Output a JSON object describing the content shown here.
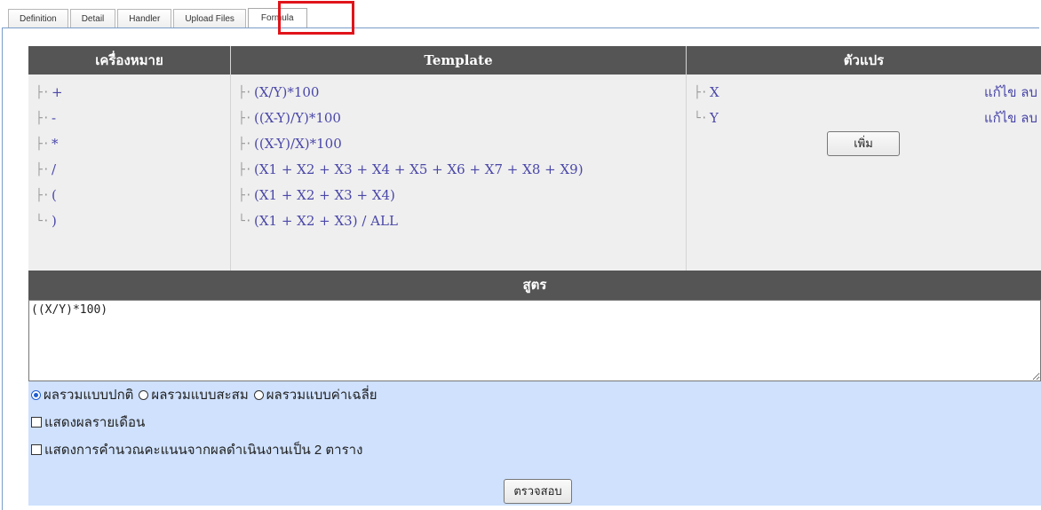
{
  "tabs": [
    {
      "label": "Definition"
    },
    {
      "label": "Detail"
    },
    {
      "label": "Handler"
    },
    {
      "label": "Upload Files"
    },
    {
      "label": "Formula",
      "active": true
    }
  ],
  "symbols": {
    "header": "เครื่องหมาย",
    "items": [
      "+",
      "-",
      "*",
      "/",
      "(",
      ")"
    ]
  },
  "templates": {
    "header": "Template",
    "items": [
      "(X/Y)*100",
      "((X-Y)/Y)*100",
      "((X-Y)/X)*100",
      "(X1 + X2 + X3 + X4 + X5 + X6 + X7 + X8 + X9)",
      "(X1 + X2 + X3 + X4)",
      "(X1 + X2 + X3) / ALL"
    ]
  },
  "variables": {
    "header": "ตัวแปร",
    "items": [
      {
        "name": "X",
        "edit": "แก้ไข",
        "delete": "ลบ"
      },
      {
        "name": "Y",
        "edit": "แก้ไข",
        "delete": "ลบ"
      }
    ],
    "add_label": "เพิ่ม"
  },
  "formula": {
    "header": "สูตร",
    "value": "((X/Y)*100)"
  },
  "options": {
    "radios": [
      {
        "label": "ผลรวมแบบปกติ",
        "checked": true
      },
      {
        "label": "ผลรวมแบบสะสม",
        "checked": false
      },
      {
        "label": "ผลรวมแบบค่าเฉลี่ย",
        "checked": false
      }
    ],
    "monthly_label": "แสดงผลรายเดือน",
    "two_tables_label": "แสดงการคำนวณคะแนนจากผลดำเนินงานเป็น 2 ตาราง",
    "verify_label": "ตรวจสอบ"
  },
  "colors": {
    "header_bg": "#555555",
    "panel_bg": "#efefef",
    "link": "#4a47a8",
    "options_bg": "#cfe1fd",
    "highlight": "#e0141a"
  }
}
